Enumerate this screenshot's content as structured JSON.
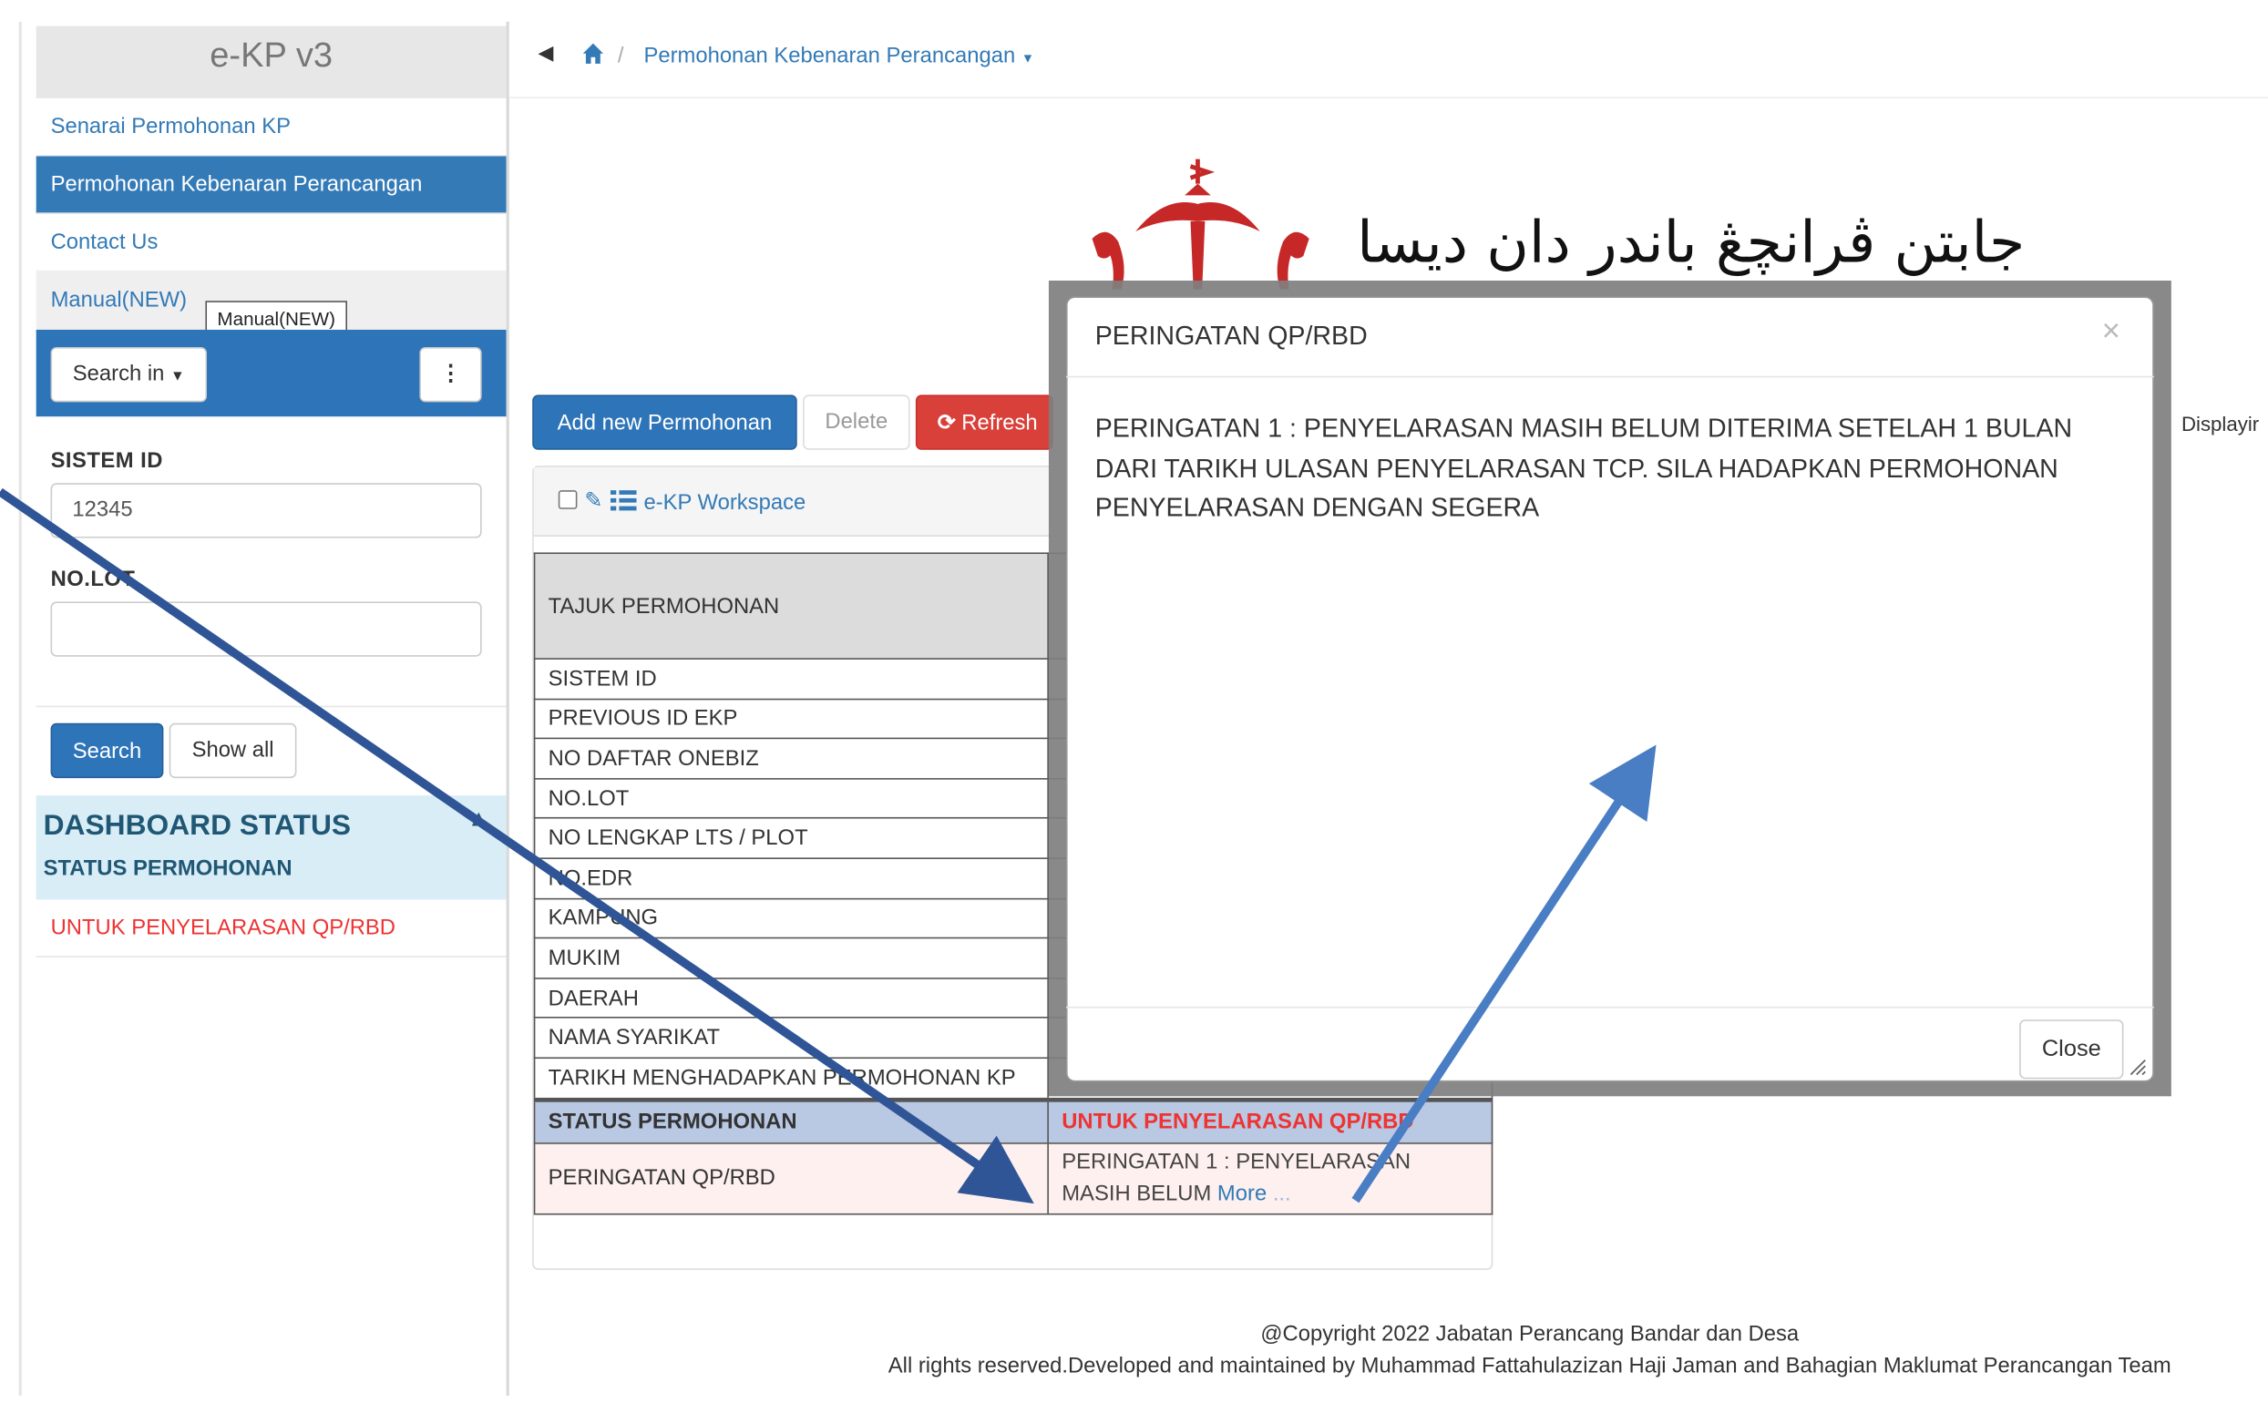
{
  "app": {
    "brand": "e-KP v3"
  },
  "sidebar": {
    "menu": [
      {
        "label": "Senarai Permohonan KP"
      },
      {
        "label": "Permohonan Kebenaran Perancangan"
      },
      {
        "label": "Contact Us"
      },
      {
        "label": "Manual(NEW)"
      }
    ],
    "tooltip": "Manual(NEW)",
    "search_in_label": "Search in",
    "kebab_icon": "⋮",
    "fields": {
      "sistem_id_label": "SISTEM ID",
      "sistem_id_value": "12345",
      "no_lot_label": "NO.LOT",
      "no_lot_value": ""
    },
    "search_button": "Search",
    "show_all_button": "Show all",
    "dashboard": {
      "title": "DASHBOARD STATUS",
      "subtitle": "STATUS PERMOHONAN",
      "items": [
        {
          "label": "UNTUK PENYELARASAN QP/RBD"
        }
      ]
    }
  },
  "breadcrumb": {
    "sep": "/",
    "current": "Permohonan Kebenaran Perancangan"
  },
  "logo": {
    "jawi_text": "جابتن ڤرانچڠ باندر دان ديسا"
  },
  "toolbar": {
    "add_label": "Add new Permohonan",
    "delete_label": "Delete",
    "refresh_label": "Refresh",
    "displaying": "Displayir"
  },
  "workspace": {
    "title": "e-KP Workspace"
  },
  "detail_table": {
    "header_label": "TAJUK PERMOHONAN",
    "rows": [
      {
        "label": "SISTEM ID",
        "value": ""
      },
      {
        "label": "PREVIOUS ID EKP",
        "value": ""
      },
      {
        "label": "NO DAFTAR ONEBIZ",
        "value": ""
      },
      {
        "label": "NO.LOT",
        "value": ""
      },
      {
        "label": "NO LENGKAP LTS / PLOT",
        "value": ""
      },
      {
        "label": "NO.EDR",
        "value": ""
      },
      {
        "label": "KAMPUNG",
        "value": ""
      },
      {
        "label": "MUKIM",
        "value": ""
      },
      {
        "label": "DAERAH",
        "value": ""
      },
      {
        "label": "NAMA SYARIKAT",
        "value": ""
      },
      {
        "label": "TARIKH MENGHADAPKAN PERMOHONAN KP",
        "value": ""
      }
    ],
    "status": {
      "label": "STATUS PERMOHONAN",
      "value": "UNTUK PENYELARASAN QP/RBD"
    },
    "warning": {
      "label": "PERINGATAN QP/RBD",
      "line1": "PERINGATAN 1 : PENYELARASAN",
      "line2": "MASIH BELUM",
      "more": "More",
      "dots": " ..."
    }
  },
  "footer": {
    "copyright": "@Copyright 2022 Jabatan Perancang Bandar dan Desa",
    "credits": "All rights reserved.Developed and maintained by Muhammad Fattahulazizan Haji Jaman and Bahagian Maklumat Perancangan Team"
  },
  "modal": {
    "title": "PERINGATAN QP/RBD",
    "close_x": "×",
    "body": "PERINGATAN 1 : PENYELARASAN MASIH BELUM DITERIMA SETELAH 1 BULAN DARI TARIKH ULASAN PENYELARASAN TCP. SILA HADAPKAN PERMOHONAN PENYELARASAN DENGAN SEGERA",
    "close_button": "Close"
  },
  "colors": {
    "primary": "#2e74b8",
    "danger": "#d9403a",
    "link": "#337ab7",
    "annotation_arrow_dark": "#2f5597",
    "annotation_arrow_light": "#4a7ec4"
  }
}
